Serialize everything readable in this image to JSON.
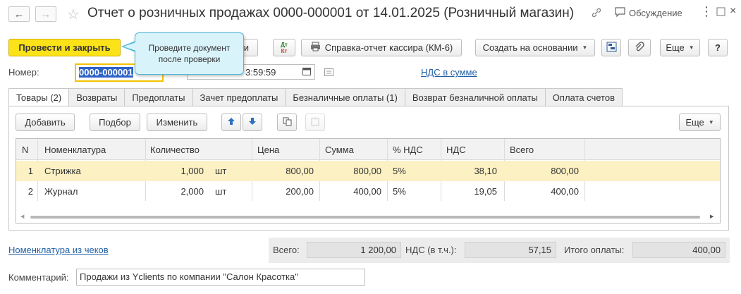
{
  "window": {
    "title": "Отчет о розничных продажах 0000-000001 от 14.01.2025 (Розничный магазин)",
    "discussion_label": "Обсуждение"
  },
  "toolbar": {
    "post_close_label": "Провести и закрыть",
    "hidden_button_tail": "и",
    "dt_kt_top": "Дт",
    "dt_kt_bottom": "Кт",
    "km6_label": "Справка-отчет кассира (КМ-6)",
    "create_based_label": "Создать на основании",
    "more_label": "Еще",
    "help_label": "?"
  },
  "tooltip": {
    "line1": "Проведите документ",
    "line2": "после проверки"
  },
  "form": {
    "number_label": "Номер:",
    "number_value": "0000-000001",
    "date_value_visible": "3:59:59",
    "vat_link": "НДС в сумме"
  },
  "tabs": [
    {
      "label": "Товары (2)",
      "active": true
    },
    {
      "label": "Возвраты",
      "active": false
    },
    {
      "label": "Предоплаты",
      "active": false
    },
    {
      "label": "Зачет предоплаты",
      "active": false
    },
    {
      "label": "Безналичные оплаты (1)",
      "active": false
    },
    {
      "label": "Возврат безналичной оплаты",
      "active": false
    },
    {
      "label": "Оплата счетов",
      "active": false
    }
  ],
  "table_toolbar": {
    "add_label": "Добавить",
    "pick_label": "Подбор",
    "change_label": "Изменить",
    "more_label": "Еще"
  },
  "table": {
    "columns": [
      "N",
      "Номенклатура",
      "Количество",
      "Цена",
      "Сумма",
      "% НДС",
      "НДС",
      "Всего"
    ],
    "rows": [
      {
        "n": "1",
        "name": "Стрижка",
        "qty": "1,000",
        "unit": "шт",
        "price": "800,00",
        "sum": "800,00",
        "vat_rate": "5%",
        "vat": "38,10",
        "total": "800,00",
        "selected": true
      },
      {
        "n": "2",
        "name": "Журнал",
        "qty": "2,000",
        "unit": "шт",
        "price": "200,00",
        "sum": "400,00",
        "vat_rate": "5%",
        "vat": "19,05",
        "total": "400,00",
        "selected": false
      }
    ]
  },
  "footer": {
    "receipts_link": "Номенклатура из чеков",
    "total_label": "Всего:",
    "total_value": "1 200,00",
    "vat_label": "НДС (в т.ч.):",
    "vat_value": "57,15",
    "paid_label": "Итого оплаты:",
    "paid_value": "400,00",
    "comment_label": "Комментарий:",
    "comment_value": "Продажи из Yclients по компании \"Салон Красотка\""
  },
  "colors": {
    "primary_button": "#fbe219",
    "selected_row": "#fbf1c3",
    "link": "#1f5fa6",
    "tooltip_bg": "#d9f3fb",
    "tooltip_border": "#4db8d8"
  }
}
